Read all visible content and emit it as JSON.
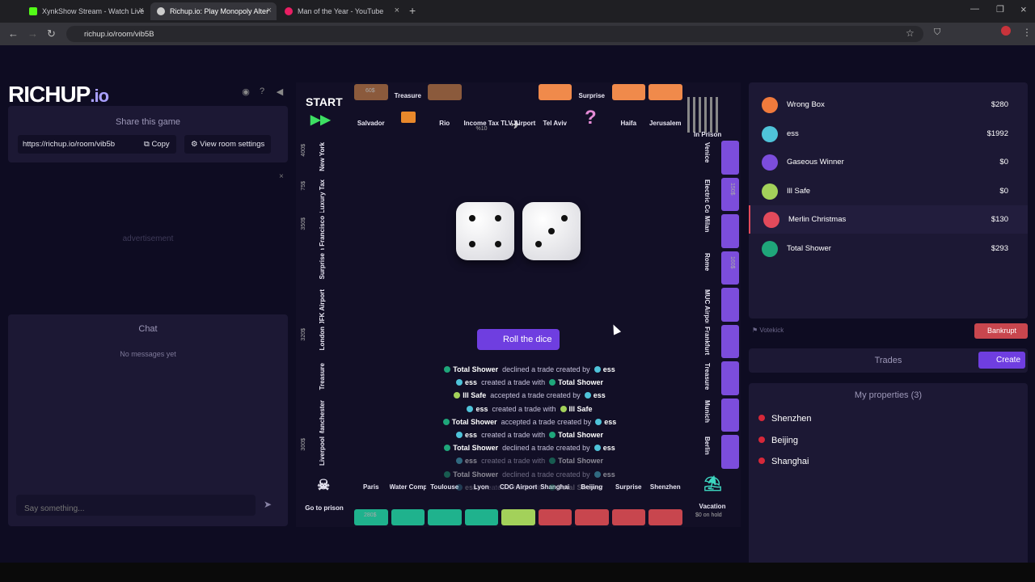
{
  "browser": {
    "tabs": [
      {
        "title": "XynkShow Stream - Watch Live",
        "favicon_color": "#53fc18"
      },
      {
        "title": "Richup.io: Play Monopoly Alter",
        "favicon_color": "#cccccc"
      },
      {
        "title": "Man of the Year - YouTube",
        "favicon_color": "#e91e63"
      }
    ],
    "url": "richup.io/room/vib5B"
  },
  "logo": {
    "main": "RICHUP",
    "suffix": ".io"
  },
  "share": {
    "title": "Share this game",
    "link": "https://richup.io/room/vib5b",
    "copy_label": "Copy",
    "settings_label": "View room settings"
  },
  "advertisement_label": "advertisement",
  "chat": {
    "title": "Chat",
    "empty": "No messages yet",
    "placeholder": "Say something..."
  },
  "board": {
    "top": [
      {
        "name": "START",
        "type": "corner"
      },
      {
        "name": "Salvador",
        "price": "60$",
        "color": "#8b5a3c"
      },
      {
        "name": "Treasure",
        "type": "treasure"
      },
      {
        "name": "Rio",
        "color": "#8b5a3c"
      },
      {
        "name": "Income Tax",
        "sub": "%10",
        "type": "tax"
      },
      {
        "name": "TLV Airport",
        "type": "airport"
      },
      {
        "name": "Tel Aviv",
        "color": "#f08a4b"
      },
      {
        "name": "Surprise",
        "type": "surprise"
      },
      {
        "name": "Haifa",
        "color": "#f08a4b"
      },
      {
        "name": "Jerusalem",
        "color": "#f08a4b"
      },
      {
        "name": "In Prison",
        "type": "corner"
      }
    ],
    "left": [
      {
        "name": "New York",
        "price": "400$"
      },
      {
        "name": "Luxury Tax",
        "price": "75$"
      },
      {
        "name": "San Francisco",
        "price": "350$"
      },
      {
        "name": "Surprise"
      },
      {
        "name": "JFK Airport"
      },
      {
        "name": "London",
        "price": "320$"
      },
      {
        "name": "Treasure"
      },
      {
        "name": "Manchester"
      },
      {
        "name": "Liverpool",
        "price": "300$"
      }
    ],
    "right": [
      {
        "name": "Venice"
      },
      {
        "name": "Electric Company",
        "price": "150$"
      },
      {
        "name": "Milan"
      },
      {
        "name": "Rome",
        "price": "160$"
      },
      {
        "name": "MUC Airport"
      },
      {
        "name": "Frankfurt"
      },
      {
        "name": "Treasure"
      },
      {
        "name": "Munich"
      },
      {
        "name": "Berlin"
      }
    ],
    "bottom": [
      {
        "name": "Go to prison",
        "type": "corner"
      },
      {
        "name": "Paris",
        "price": "280$"
      },
      {
        "name": "Water Company"
      },
      {
        "name": "Toulouse"
      },
      {
        "name": "Lyon"
      },
      {
        "name": "CDG Airport"
      },
      {
        "name": "Shanghai"
      },
      {
        "name": "Beijing"
      },
      {
        "name": "Surprise"
      },
      {
        "name": "Shenzhen"
      },
      {
        "name": "Vacation",
        "sub": "$0 on hold",
        "type": "corner"
      }
    ],
    "roll_label": "Roll the dice",
    "dice": [
      4,
      3
    ]
  },
  "log": [
    {
      "a": "Total Shower",
      "act": "declined a trade created by",
      "b": "ess",
      "ca": "#1fa67a",
      "cb": "#4fc3d9"
    },
    {
      "a": "ess",
      "act": "created a trade with",
      "b": "Total Shower",
      "ca": "#4fc3d9",
      "cb": "#1fa67a"
    },
    {
      "a": "Ill Safe",
      "act": "accepted a trade created by",
      "b": "ess",
      "ca": "#a3d15a",
      "cb": "#4fc3d9"
    },
    {
      "a": "ess",
      "act": "created a trade with",
      "b": "Ill Safe",
      "ca": "#4fc3d9",
      "cb": "#a3d15a"
    },
    {
      "a": "Total Shower",
      "act": "accepted a trade created by",
      "b": "ess",
      "ca": "#1fa67a",
      "cb": "#4fc3d9"
    },
    {
      "a": "ess",
      "act": "created a trade with",
      "b": "Total Shower",
      "ca": "#4fc3d9",
      "cb": "#1fa67a"
    },
    {
      "a": "Total Shower",
      "act": "declined a trade created by",
      "b": "ess",
      "ca": "#1fa67a",
      "cb": "#4fc3d9"
    },
    {
      "a": "ess",
      "act": "created a trade with",
      "b": "Total Shower",
      "ca": "#4fc3d9",
      "cb": "#1fa67a"
    },
    {
      "a": "Total Shower",
      "act": "declined a trade created by",
      "b": "ess",
      "ca": "#1fa67a",
      "cb": "#4fc3d9"
    },
    {
      "a": "ess",
      "act": "created a trade with",
      "b": "Total Shower",
      "ca": "#4fc3d9",
      "cb": "#1fa67a"
    }
  ],
  "players": [
    {
      "name": "Wrong Box",
      "money": "$280",
      "color": "#f07a3c"
    },
    {
      "name": "ess",
      "money": "$1992",
      "color": "#4fc3d9"
    },
    {
      "name": "Gaseous Winner",
      "money": "$0",
      "color": "#7c4ddc"
    },
    {
      "name": "Ill Safe",
      "money": "$0",
      "color": "#a3d15a"
    },
    {
      "name": "Merlin Christmas",
      "money": "$130",
      "color": "#e24a5b"
    },
    {
      "name": "Total Shower",
      "money": "$293",
      "color": "#1fa67a"
    }
  ],
  "votekick_label": "Votekick",
  "bankrupt_label": "Bankrupt",
  "trades_title": "Trades",
  "create_label": "Create",
  "properties": {
    "title": "My properties (3)",
    "items": [
      "Shenzhen",
      "Beijing",
      "Shanghai"
    ]
  }
}
